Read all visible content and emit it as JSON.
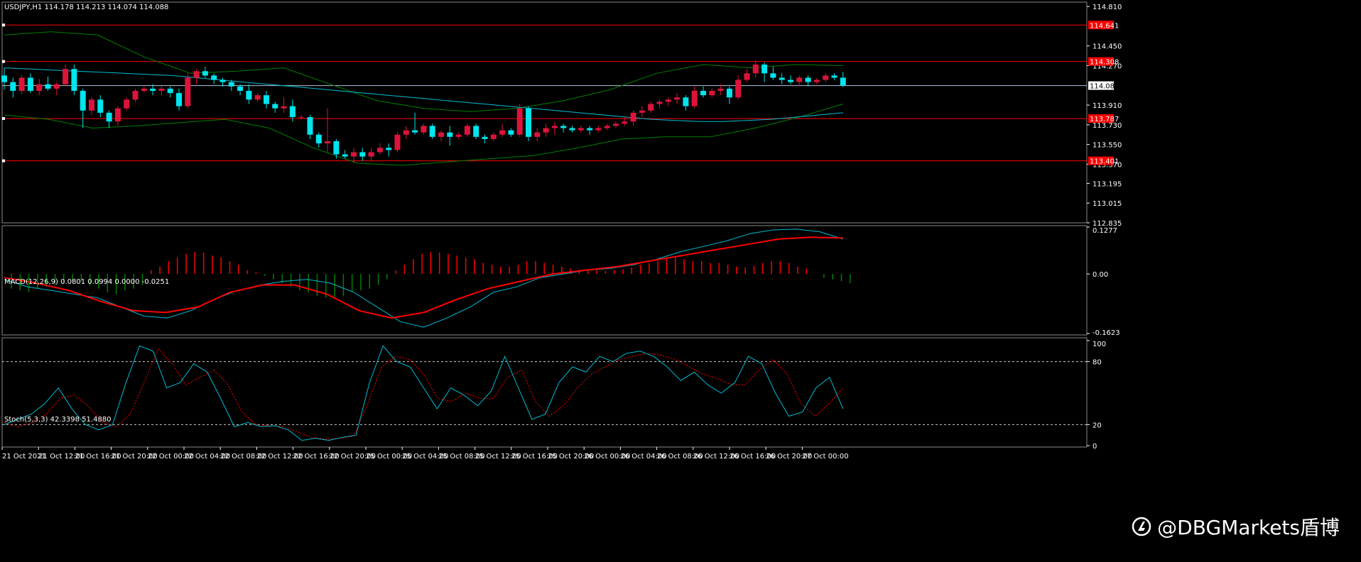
{
  "main": {
    "info": "USDJPY,H1  114.178 114.213 114.074 114.088",
    "price_ticks": [
      "114.810",
      "114.450",
      "114.270",
      "113.910",
      "113.730",
      "113.550",
      "113.370",
      "113.195",
      "113.015",
      "112.835"
    ],
    "tick_values": [
      114.81,
      114.45,
      114.27,
      113.91,
      113.73,
      113.55,
      113.37,
      113.195,
      113.015,
      112.835
    ],
    "current_price": "114.088",
    "levels": [
      {
        "value": 114.641,
        "label": "114.641"
      },
      {
        "value": 114.308,
        "label": "114.308"
      },
      {
        "value": 113.787,
        "label": "113.787"
      },
      {
        "value": 113.401,
        "label": "113.401"
      }
    ]
  },
  "macd": {
    "info": "MACD(12,26,9) 0.0801 0.0994 0.0000 -0.0251",
    "ticks": [
      "0.1277",
      "0.00",
      "-0.1623"
    ]
  },
  "stoch": {
    "info": "Stoch(5,3,3) 42.3398 51.4880",
    "ticks": [
      "100",
      "80",
      "20",
      "0"
    ]
  },
  "time_labels": [
    "21 Oct 2021",
    "21 Oct 12:00",
    "21 Oct 16:00",
    "21 Oct 20:00",
    "22 Oct 00:00",
    "22 Oct 04:00",
    "22 Oct 08:00",
    "22 Oct 12:00",
    "22 Oct 16:00",
    "22 Oct 20:00",
    "25 Oct 00:00",
    "25 Oct 04:00",
    "25 Oct 08:00",
    "25 Oct 12:00",
    "25 Oct 16:00",
    "25 Oct 20:00",
    "26 Oct 00:00",
    "26 Oct 04:00",
    "26 Oct 08:00",
    "26 Oct 12:00",
    "26 Oct 16:00",
    "26 Oct 20:00",
    "27 Oct 00:00"
  ],
  "watermark": "@DBGMarkets盾博",
  "colors": {
    "bull": "#dc143c",
    "bear": "#00e5ee",
    "level": "#ff0000",
    "band": "#008000",
    "ma": "#00bcd4",
    "signal": "#ff0000"
  },
  "chart_data": [
    {
      "type": "candlestick",
      "title": "USDJPY,H1",
      "ylim": [
        112.835,
        114.85
      ],
      "x": "hourly bars, 21 Oct 2021 09:00 - 27 Oct 2021 01:00",
      "ohlc": [
        [
          114.18,
          114.25,
          114.05,
          114.12
        ],
        [
          114.12,
          114.16,
          113.98,
          114.04
        ],
        [
          114.04,
          114.18,
          114.01,
          114.16
        ],
        [
          114.16,
          114.2,
          114.02,
          114.04
        ],
        [
          114.04,
          114.15,
          114.0,
          114.1
        ],
        [
          114.1,
          114.17,
          114.04,
          114.06
        ],
        [
          114.06,
          114.12,
          114.0,
          114.1
        ],
        [
          114.1,
          114.28,
          114.08,
          114.24
        ],
        [
          114.24,
          114.28,
          114.0,
          114.04
        ],
        [
          114.04,
          114.06,
          113.7,
          113.86
        ],
        [
          113.86,
          113.98,
          113.82,
          113.96
        ],
        [
          113.96,
          114.0,
          113.8,
          113.84
        ],
        [
          113.84,
          113.86,
          113.7,
          113.76
        ],
        [
          113.76,
          113.9,
          113.72,
          113.88
        ],
        [
          113.88,
          113.98,
          113.86,
          113.96
        ],
        [
          113.96,
          114.06,
          113.94,
          114.04
        ],
        [
          114.04,
          114.08,
          114.02,
          114.06
        ],
        [
          114.06,
          114.1,
          114.0,
          114.04
        ],
        [
          114.04,
          114.08,
          114.0,
          114.06
        ],
        [
          114.06,
          114.08,
          113.98,
          114.02
        ],
        [
          114.02,
          114.06,
          113.86,
          113.9
        ],
        [
          113.9,
          114.2,
          113.88,
          114.16
        ],
        [
          114.16,
          114.24,
          114.1,
          114.22
        ],
        [
          114.22,
          114.26,
          114.16,
          114.18
        ],
        [
          114.18,
          114.2,
          114.1,
          114.14
        ],
        [
          114.14,
          114.16,
          114.08,
          114.12
        ],
        [
          114.12,
          114.14,
          114.04,
          114.08
        ],
        [
          114.08,
          114.1,
          114.0,
          114.04
        ],
        [
          114.04,
          114.1,
          113.92,
          113.96
        ],
        [
          113.96,
          114.02,
          113.94,
          114.0
        ],
        [
          114.0,
          114.04,
          113.88,
          113.92
        ],
        [
          113.92,
          113.94,
          113.84,
          113.88
        ],
        [
          113.88,
          113.98,
          113.84,
          113.9
        ],
        [
          113.9,
          113.96,
          113.76,
          113.8
        ],
        [
          113.8,
          113.82,
          113.78,
          113.8
        ],
        [
          113.8,
          113.82,
          113.6,
          113.64
        ],
        [
          113.64,
          113.66,
          113.52,
          113.56
        ],
        [
          113.56,
          113.88,
          113.48,
          113.58
        ],
        [
          113.58,
          113.6,
          113.42,
          113.46
        ],
        [
          113.46,
          113.5,
          113.42,
          113.44
        ],
        [
          113.44,
          113.52,
          113.38,
          113.48
        ],
        [
          113.48,
          113.52,
          113.4,
          113.44
        ],
        [
          113.44,
          113.52,
          113.4,
          113.48
        ],
        [
          113.48,
          113.56,
          113.46,
          113.52
        ],
        [
          113.52,
          113.56,
          113.44,
          113.5
        ],
        [
          113.5,
          113.66,
          113.48,
          113.64
        ],
        [
          113.64,
          113.72,
          113.6,
          113.68
        ],
        [
          113.68,
          113.84,
          113.64,
          113.66
        ],
        [
          113.66,
          113.74,
          113.64,
          113.72
        ],
        [
          113.72,
          113.74,
          113.6,
          113.62
        ],
        [
          113.62,
          113.68,
          113.58,
          113.66
        ],
        [
          113.66,
          113.72,
          113.54,
          113.62
        ],
        [
          113.62,
          113.66,
          113.6,
          113.64
        ],
        [
          113.64,
          113.74,
          113.62,
          113.72
        ],
        [
          113.72,
          113.74,
          113.6,
          113.62
        ],
        [
          113.62,
          113.64,
          113.56,
          113.6
        ],
        [
          113.6,
          113.66,
          113.58,
          113.64
        ],
        [
          113.64,
          113.74,
          113.62,
          113.68
        ],
        [
          113.68,
          113.7,
          113.62,
          113.64
        ],
        [
          113.64,
          113.92,
          113.62,
          113.88
        ],
        [
          113.88,
          113.9,
          113.58,
          113.62
        ],
        [
          113.62,
          113.7,
          113.58,
          113.66
        ],
        [
          113.66,
          113.74,
          113.62,
          113.7
        ],
        [
          113.7,
          113.76,
          113.64,
          113.72
        ],
        [
          113.72,
          113.74,
          113.66,
          113.7
        ],
        [
          113.7,
          113.72,
          113.66,
          113.68
        ],
        [
          113.68,
          113.72,
          113.66,
          113.7
        ],
        [
          113.7,
          113.72,
          113.64,
          113.68
        ],
        [
          113.68,
          113.72,
          113.66,
          113.7
        ],
        [
          113.7,
          113.74,
          113.68,
          113.72
        ],
        [
          113.72,
          113.76,
          113.7,
          113.74
        ],
        [
          113.74,
          113.8,
          113.72,
          113.76
        ],
        [
          113.76,
          113.86,
          113.72,
          113.84
        ],
        [
          113.84,
          113.9,
          113.8,
          113.86
        ],
        [
          113.86,
          113.94,
          113.84,
          113.92
        ],
        [
          113.92,
          113.96,
          113.88,
          113.94
        ],
        [
          113.94,
          113.98,
          113.9,
          113.96
        ],
        [
          113.96,
          114.02,
          113.92,
          113.98
        ],
        [
          113.98,
          114.0,
          113.86,
          113.9
        ],
        [
          113.9,
          114.08,
          113.88,
          114.04
        ],
        [
          114.04,
          114.08,
          113.98,
          114.0
        ],
        [
          114.0,
          114.06,
          113.98,
          114.04
        ],
        [
          114.04,
          114.1,
          114.0,
          114.06
        ],
        [
          114.06,
          114.08,
          113.92,
          113.98
        ],
        [
          113.98,
          114.18,
          113.96,
          114.14
        ],
        [
          114.14,
          114.24,
          114.12,
          114.2
        ],
        [
          114.2,
          114.32,
          114.16,
          114.28
        ],
        [
          114.28,
          114.3,
          114.12,
          114.2
        ],
        [
          114.2,
          114.26,
          114.14,
          114.16
        ],
        [
          114.16,
          114.2,
          114.1,
          114.14
        ],
        [
          114.14,
          114.18,
          114.1,
          114.12
        ],
        [
          114.12,
          114.18,
          114.08,
          114.16
        ],
        [
          114.16,
          114.18,
          114.08,
          114.12
        ],
        [
          114.12,
          114.16,
          114.1,
          114.14
        ],
        [
          114.14,
          114.2,
          114.12,
          114.18
        ],
        [
          114.18,
          114.2,
          114.14,
          114.16
        ],
        [
          114.16,
          114.213,
          114.074,
          114.088
        ]
      ],
      "ma": [
        114.25,
        114.24,
        114.23,
        114.22,
        114.21,
        114.2,
        114.19,
        114.18,
        114.16,
        114.14,
        114.12,
        114.1,
        114.08,
        114.06,
        114.04,
        114.02,
        114.0,
        113.98,
        113.96,
        113.94,
        113.92,
        113.9,
        113.88,
        113.86,
        113.84,
        113.82,
        113.8,
        113.78,
        113.77,
        113.76,
        113.76,
        113.77,
        113.78,
        113.8,
        113.82,
        113.84
      ],
      "bb_upper": [
        114.55,
        114.58,
        114.55,
        114.35,
        114.2,
        114.22,
        114.25,
        114.1,
        113.95,
        113.88,
        113.85,
        113.88,
        113.95,
        114.05,
        114.2,
        114.28,
        114.25,
        114.28,
        114.27
      ],
      "bb_lower": [
        113.82,
        113.78,
        113.7,
        113.72,
        113.75,
        113.78,
        113.7,
        113.52,
        113.38,
        113.36,
        113.39,
        113.42,
        113.45,
        113.52,
        113.6,
        113.62,
        113.62,
        113.7,
        113.8,
        113.92
      ]
    },
    {
      "type": "bar",
      "title": "MACD(12,26,9)",
      "ylim": [
        -0.1623,
        0.1277
      ],
      "histogram": [
        -0.04,
        -0.045,
        -0.05,
        -0.04,
        -0.035,
        -0.03,
        -0.025,
        -0.02,
        -0.02,
        -0.03,
        -0.04,
        -0.05,
        -0.055,
        -0.045,
        -0.04,
        -0.03,
        0.01,
        0.02,
        0.035,
        0.045,
        0.055,
        0.06,
        0.058,
        0.05,
        0.045,
        0.035,
        0.025,
        0.01,
        0.005,
        -0.005,
        -0.015,
        -0.025,
        -0.035,
        -0.045,
        -0.05,
        -0.06,
        -0.065,
        -0.065,
        -0.06,
        -0.05,
        -0.045,
        -0.04,
        -0.03,
        -0.015,
        0.01,
        0.025,
        0.04,
        0.055,
        0.06,
        0.058,
        0.055,
        0.05,
        0.045,
        0.04,
        0.03,
        0.025,
        0.02,
        0.02,
        0.025,
        0.035,
        0.035,
        0.03,
        0.025,
        0.02,
        0.015,
        0.012,
        0.01,
        0.01,
        0.008,
        0.01,
        0.012,
        0.018,
        0.025,
        0.03,
        0.035,
        0.04,
        0.045,
        0.04,
        0.035,
        0.035,
        0.03,
        0.03,
        0.025,
        0.02,
        0.018,
        0.022,
        0.03,
        0.035,
        0.035,
        0.03,
        0.02,
        0.015,
        0.0,
        -0.01,
        -0.015,
        -0.02,
        -0.025
      ],
      "macd_line": [
        -0.015,
        -0.035,
        -0.045,
        -0.055,
        -0.065,
        -0.09,
        -0.115,
        -0.12,
        -0.1,
        -0.07,
        -0.045,
        -0.03,
        -0.02,
        -0.015,
        -0.025,
        -0.05,
        -0.09,
        -0.13,
        -0.145,
        -0.12,
        -0.09,
        -0.05,
        -0.035,
        -0.01,
        0.0,
        0.01,
        0.015,
        0.025,
        0.04,
        0.06,
        0.075,
        0.09,
        0.11,
        0.12,
        0.122,
        0.115,
        0.095
      ],
      "signal_line": [
        -0.01,
        -0.025,
        -0.045,
        -0.075,
        -0.1,
        -0.105,
        -0.09,
        -0.05,
        -0.03,
        -0.03,
        -0.055,
        -0.1,
        -0.12,
        -0.105,
        -0.07,
        -0.04,
        -0.02,
        0.0,
        0.01,
        0.02,
        0.035,
        0.05,
        0.065,
        0.08,
        0.095,
        0.1,
        0.098
      ]
    },
    {
      "type": "line",
      "title": "Stoch(5,3,3)",
      "ylim": [
        0,
        100
      ],
      "k": [
        20,
        25,
        30,
        40,
        55,
        35,
        20,
        15,
        20,
        60,
        95,
        90,
        55,
        60,
        78,
        70,
        45,
        18,
        22,
        18,
        19,
        15,
        5,
        7,
        5,
        8,
        10,
        60,
        95,
        80,
        75,
        55,
        35,
        55,
        48,
        38,
        52,
        85,
        55,
        25,
        30,
        60,
        75,
        70,
        85,
        80,
        88,
        90,
        85,
        75,
        62,
        70,
        58,
        50,
        60,
        85,
        78,
        50,
        28,
        32,
        55,
        65,
        35
      ],
      "d": [
        22,
        18,
        22,
        30,
        45,
        48,
        38,
        22,
        18,
        30,
        60,
        92,
        78,
        58,
        65,
        72,
        58,
        32,
        20,
        19,
        18,
        13,
        8,
        6,
        7,
        9,
        40,
        75,
        85,
        82,
        68,
        45,
        42,
        50,
        45,
        45,
        65,
        72,
        42,
        28,
        38,
        55,
        68,
        75,
        82,
        85,
        88,
        86,
        82,
        75,
        68,
        64,
        58,
        58,
        72,
        82,
        68,
        40,
        28,
        40,
        55
      ]
    }
  ]
}
